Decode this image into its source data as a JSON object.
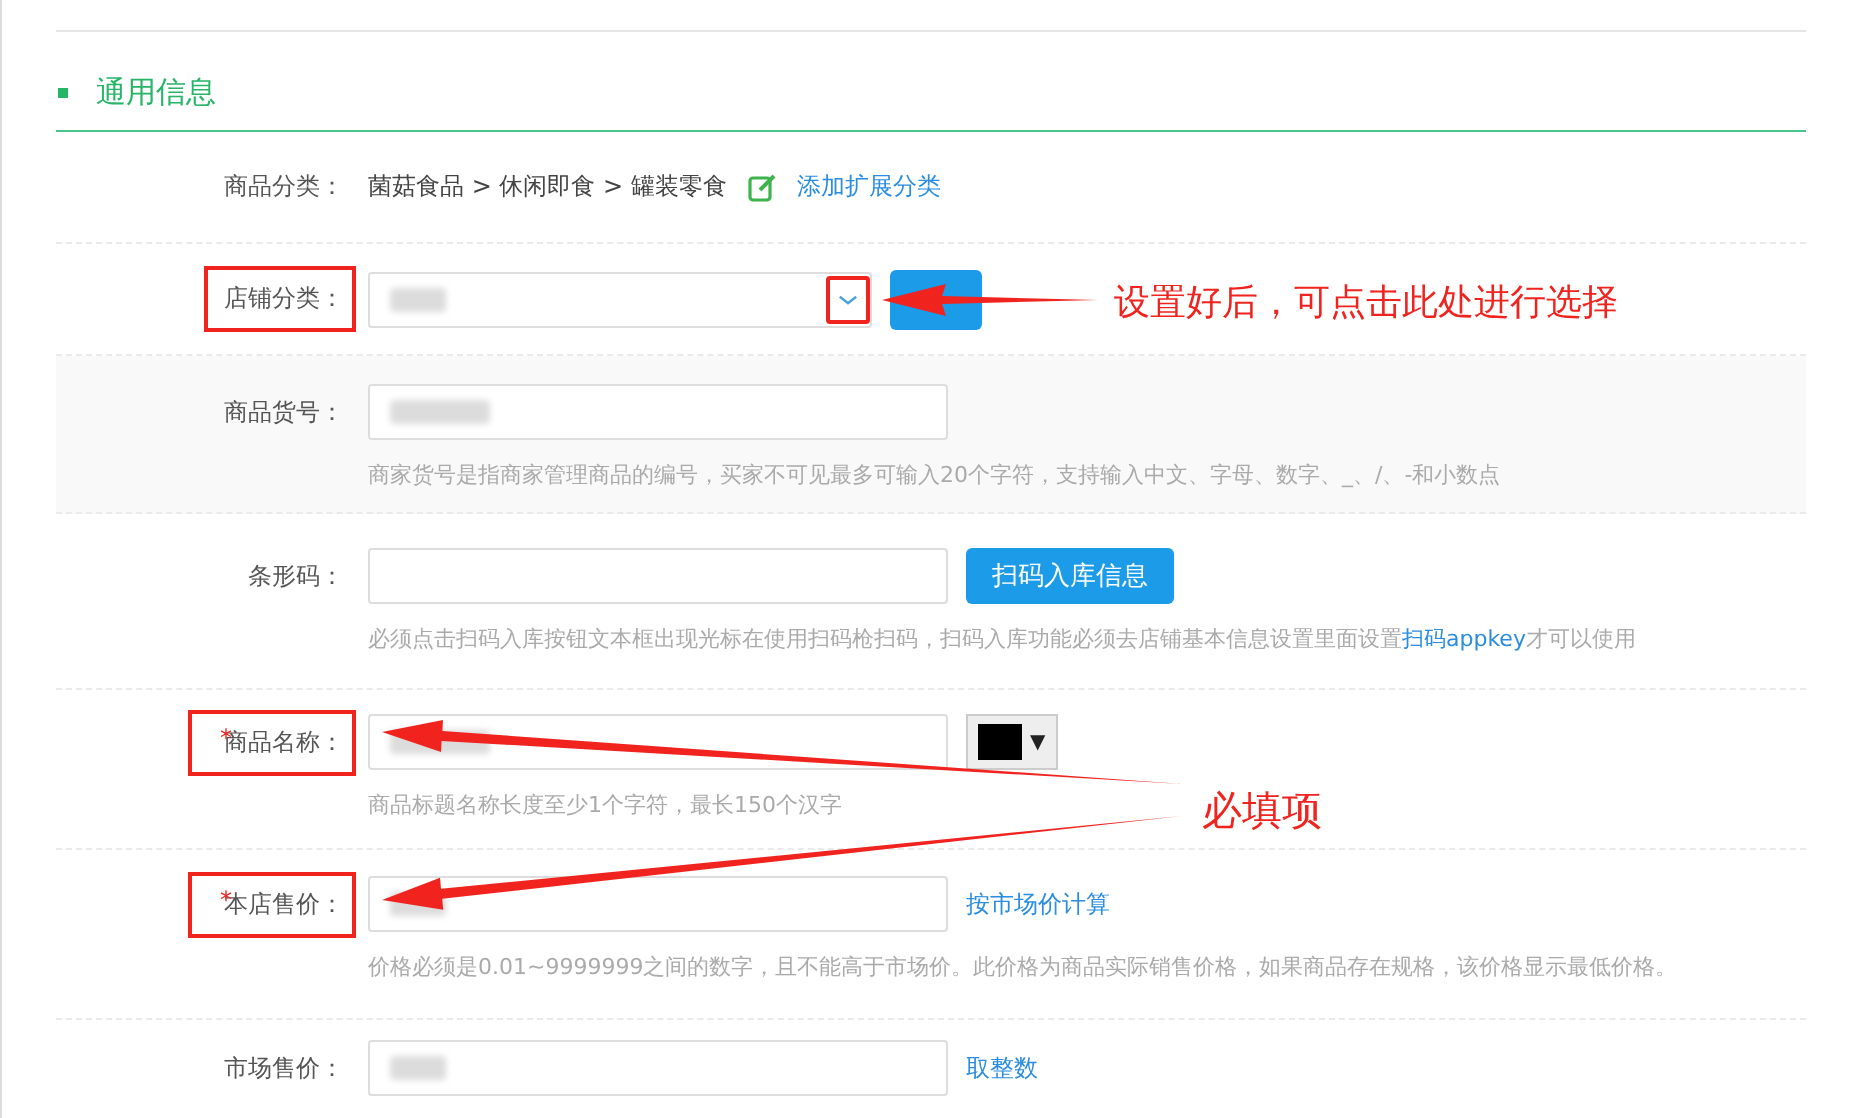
{
  "section": {
    "title": "通用信息"
  },
  "rows": [
    {
      "kind": "category",
      "label": "商品分类：",
      "path": "菌菇食品 > 休闲即食 > 罐装零食",
      "link": "添加扩展分类",
      "highlighted": false
    },
    {
      "kind": "select",
      "label": "店铺分类：",
      "blurred": true,
      "highlighted": true,
      "caret_highlighted": true
    },
    {
      "kind": "text",
      "label": "商品货号：",
      "blurred": true,
      "shaded": true,
      "hint": "商家货号是指商家管理商品的编号，买家不可见最多可输入20个字符，支持输入中文、字母、数字、_、/、-和小数点",
      "highlighted": false
    },
    {
      "kind": "barcode",
      "label": "条形码：",
      "button": "扫码入库信息",
      "hint_before": "必须点击扫码入库按钮文本框出现光标在使用扫码枪扫码，扫码入库功能必须去店铺基本信息设置里面设置",
      "hint_link": "扫码appkey",
      "hint_after": "才可以使用",
      "highlighted": false
    },
    {
      "kind": "name",
      "label": "商品名称：",
      "required_mark": "*",
      "highlighted": true,
      "blurred": true,
      "picker_arrow": "▼",
      "hint": "商品标题名称长度至少1个字符，最长150个汉字"
    },
    {
      "kind": "price",
      "label": "本店售价：",
      "required_mark": "*",
      "highlighted": true,
      "blurred": true,
      "link": "按市场价计算",
      "hint": "价格必须是0.01~9999999之间的数字，且不能高于市场价。此价格为商品实际销售价格，如果商品存在规格，该价格显示最低价格。"
    },
    {
      "kind": "price",
      "label": "市场售价：",
      "highlighted": false,
      "blurred": true,
      "link": "取整数"
    }
  ],
  "annotations": [
    {
      "text": "设置好后，可点击此处进行选择"
    },
    {
      "text": "必填项"
    }
  ]
}
